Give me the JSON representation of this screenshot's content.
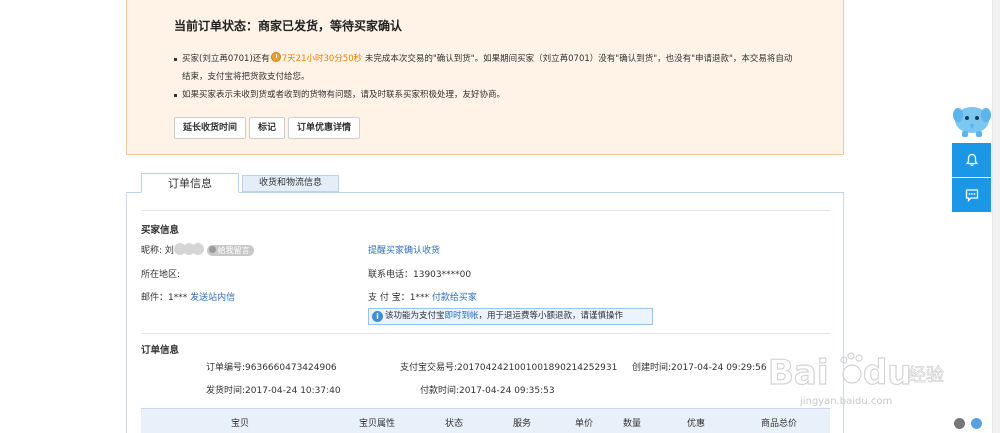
{
  "status": {
    "title": "当前订单状态：商家已发货，等待买家确认",
    "line1_pre": "买家(刘立苒0701)还有",
    "countdown": "7天21小时30分50秒",
    "line1_post": "未完成本次交易的\"确认到货\"。如果期间买家（刘立苒0701）没有\"确认到货\"，也没有\"申请退款\"，本交易将自动",
    "line1_cont": "结束，支付宝将把货款支付给您。",
    "line2": "如果买家表示未收到货或者收到的货物有问题，请及时联系买家积极处理，友好协商。",
    "buttons": [
      "延长收货时间",
      "标记",
      "订单优惠详情"
    ]
  },
  "tabs": {
    "order_info": "订单信息",
    "logistics": "收货和物流信息"
  },
  "buyer": {
    "section_title": "买家信息",
    "nickname_label": "昵称:",
    "nickname_initial": "刘",
    "message_badge": "给我留言",
    "remind_link": "提醒买家确认收货",
    "region_label": "所在地区:",
    "phone": "联系电话：13903****00",
    "mail_label": "邮件：",
    "mail_value": "1***",
    "mail_link": "发送站内信",
    "alipay_label": "支 付 宝：",
    "alipay_value": "1***",
    "alipay_link": "付款给买家",
    "notice_pre": "该功能为支付宝",
    "notice_link": "即时到帐",
    "notice_post": "，用于退运费等小额退款，请谨慎操作"
  },
  "order": {
    "section_title": "订单信息",
    "order_no": "订单编号:9636660473424906",
    "alipay_trade_no": "支付宝交易号:2017042421001001890214252931",
    "created_time": "创建时间:2017-04-24 09:29:56",
    "ship_time": "发货时间:2017-04-24 10:37:40",
    "pay_time": "付款时间:2017-04-24 09:35:53"
  },
  "table_headers": [
    "宝贝",
    "宝贝属性",
    "状态",
    "服务",
    "单价",
    "数量",
    "优惠",
    "商品总价"
  ],
  "watermark": {
    "brand": "Bai",
    "brand2": "du",
    "cn": "经验",
    "url": "jingyan.baidu.com"
  },
  "colors": {
    "status_bg": "#fff3e8",
    "link": "#2f6ebe",
    "countdown": "#f08000",
    "float_blue": "#1a97e6"
  }
}
